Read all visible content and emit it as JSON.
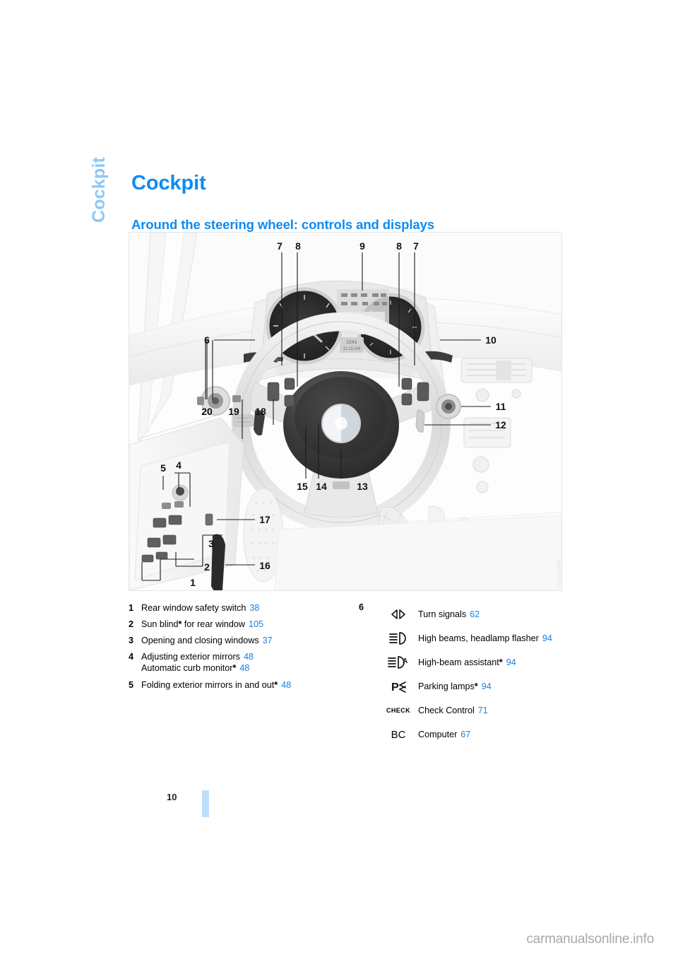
{
  "chapter": {
    "tab_label": "Cockpit",
    "title": "Cockpit"
  },
  "section": {
    "title": "Around the steering wheel: controls and displays"
  },
  "illustration": {
    "code": "HOCKPIT0A",
    "callouts": [
      "7",
      "8",
      "9",
      "8",
      "7",
      "6",
      "10",
      "11",
      "12",
      "20",
      "19",
      "18",
      "15",
      "14",
      "13",
      "5",
      "4",
      "17",
      "3",
      "2",
      "1",
      "16"
    ]
  },
  "legend_left": [
    {
      "num": "1",
      "lines": [
        {
          "text": "Rear window safety switch",
          "star": false,
          "page": "38"
        }
      ]
    },
    {
      "num": "2",
      "lines": [
        {
          "text": "Sun blind",
          "star": true,
          "suffix": " for rear window",
          "page": "105"
        }
      ]
    },
    {
      "num": "3",
      "lines": [
        {
          "text": "Opening and closing windows",
          "star": false,
          "page": "37"
        }
      ]
    },
    {
      "num": "4",
      "lines": [
        {
          "text": "Adjusting exterior mirrors",
          "star": false,
          "page": "48"
        },
        {
          "text": "Automatic curb monitor",
          "star": true,
          "page": "48"
        }
      ]
    },
    {
      "num": "5",
      "lines": [
        {
          "text": "Folding exterior mirrors in and out",
          "star": true,
          "page": "48"
        }
      ]
    }
  ],
  "legend_right": {
    "num": "6",
    "rows": [
      {
        "icon": "turn-signals-icon",
        "label": "Turn signals",
        "star": false,
        "page": "62"
      },
      {
        "icon": "high-beams-icon",
        "label": "High beams, headlamp flasher",
        "star": false,
        "page": "94"
      },
      {
        "icon": "high-beam-assistant-icon",
        "label": "High-beam assistant",
        "star": true,
        "page": "94"
      },
      {
        "icon": "parking-lamps-icon",
        "label": "Parking lamps",
        "star": true,
        "page": "94"
      },
      {
        "icon": "check-control-icon",
        "label": "Check Control",
        "star": false,
        "page": "71",
        "glyph": "CHECK"
      },
      {
        "icon": "computer-icon",
        "label": "Computer",
        "star": false,
        "page": "67",
        "glyph": "BC"
      }
    ]
  },
  "footer": {
    "page_number": "10",
    "watermark": "carmanualsonline.info"
  },
  "colors": {
    "heading_blue": "#0d8bf2",
    "tab_blue": "#8cc8f5",
    "page_ref_blue": "#1a7fe0",
    "folio_bar": "#bfe0fb"
  }
}
